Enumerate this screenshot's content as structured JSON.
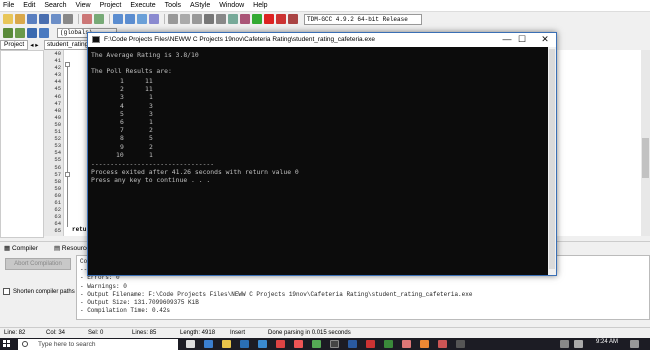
{
  "menu": [
    "File",
    "Edit",
    "Search",
    "View",
    "Project",
    "Execute",
    "Tools",
    "AStyle",
    "Window",
    "Help"
  ],
  "toolbar": {
    "compiler_select": "TDM-GCC 4.9.2 64-bit Release",
    "scope_select": "(globals)"
  },
  "project_panel": {
    "tab_project": "Project",
    "nav": "◂ ▸"
  },
  "editor": {
    "tab_label": "student_rating_c",
    "line_numbers": [
      "40",
      "41",
      "42",
      "43",
      "44",
      "45",
      "46",
      "47",
      "48",
      "49",
      "50",
      "51",
      "52",
      "53",
      "54",
      "55",
      "56",
      "57",
      "58",
      "59",
      "60",
      "61",
      "62",
      "63",
      "64",
      "65"
    ],
    "visible_code": "return"
  },
  "console": {
    "title": "F:\\Code Projects Files\\NEWW C Projects 19nov\\Cafeteria Rating\\student_rating_cafeteria.exe",
    "minimize": "—",
    "maximize": "☐",
    "close": "✕",
    "average_line": "The Average Rating is 3.8/10",
    "poll_heading": "The Poll Results are:",
    "poll": [
      {
        "rating": "1",
        "count": "11"
      },
      {
        "rating": "2",
        "count": "11"
      },
      {
        "rating": "3",
        "count": "1"
      },
      {
        "rating": "4",
        "count": "3"
      },
      {
        "rating": "5",
        "count": "3"
      },
      {
        "rating": "6",
        "count": "1"
      },
      {
        "rating": "7",
        "count": "2"
      },
      {
        "rating": "8",
        "count": "5"
      },
      {
        "rating": "9",
        "count": "2"
      },
      {
        "rating": "10",
        "count": "1"
      }
    ],
    "divider": "--------------------------------",
    "exit_line": "Process exited after 41.26 seconds with return value 0",
    "continue_line": "Press any key to continue . . ."
  },
  "bottom": {
    "tab_compiler": "Compiler",
    "tab_resources": "Resources",
    "abort_button": "Abort Compilation",
    "shorten_label": "Shorten compiler paths",
    "log_lines": [
      "Comp",
      "----",
      "- Errors: 0",
      "- Warnings: 0",
      "- Output Filename: F:\\Code Projects Files\\NEWW C Projects 19nov\\Cafeteria Rating\\student_rating_cafeteria.exe",
      "- Output Size: 131.7099609375 KiB",
      "- Compilation Time: 0.42s"
    ]
  },
  "status": {
    "line": "Line:    82",
    "col": "Col:    34",
    "sel": "Sel:    0",
    "lines": "Lines:    85",
    "length": "Length:  4918",
    "mode": "Insert",
    "message": "Done parsing in 0.015 seconds"
  },
  "taskbar": {
    "search_placeholder": "Type here to search",
    "time": "9:24 AM"
  },
  "colors": {
    "console_bg": "#0c0c0c",
    "console_text": "#c0c0c0",
    "title_accent": "#3a6fb5",
    "taskbar": "#1c1c24"
  }
}
